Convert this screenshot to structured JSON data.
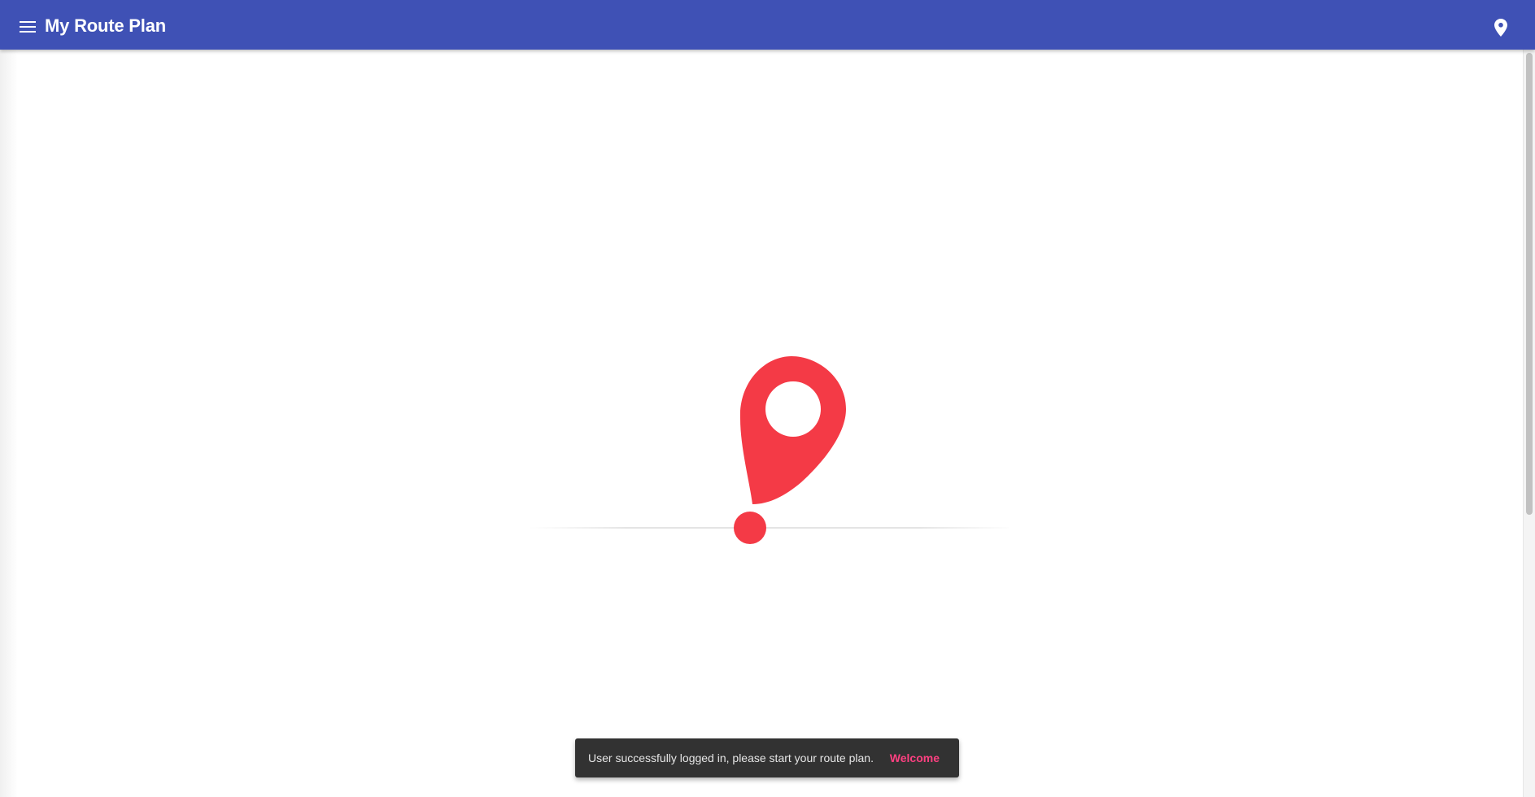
{
  "toolbar": {
    "title": "My Route Plan",
    "menu_icon": "menu-icon",
    "action_icon": "location-pin-icon",
    "color": "#3f51b5"
  },
  "hero": {
    "icon": "location-pin-illustration",
    "pin_color": "#f43a46"
  },
  "snackbar": {
    "message": "User successfully logged in, please start your route plan.",
    "action_label": "Welcome",
    "action_color": "#ff4081",
    "background": "#323232"
  }
}
